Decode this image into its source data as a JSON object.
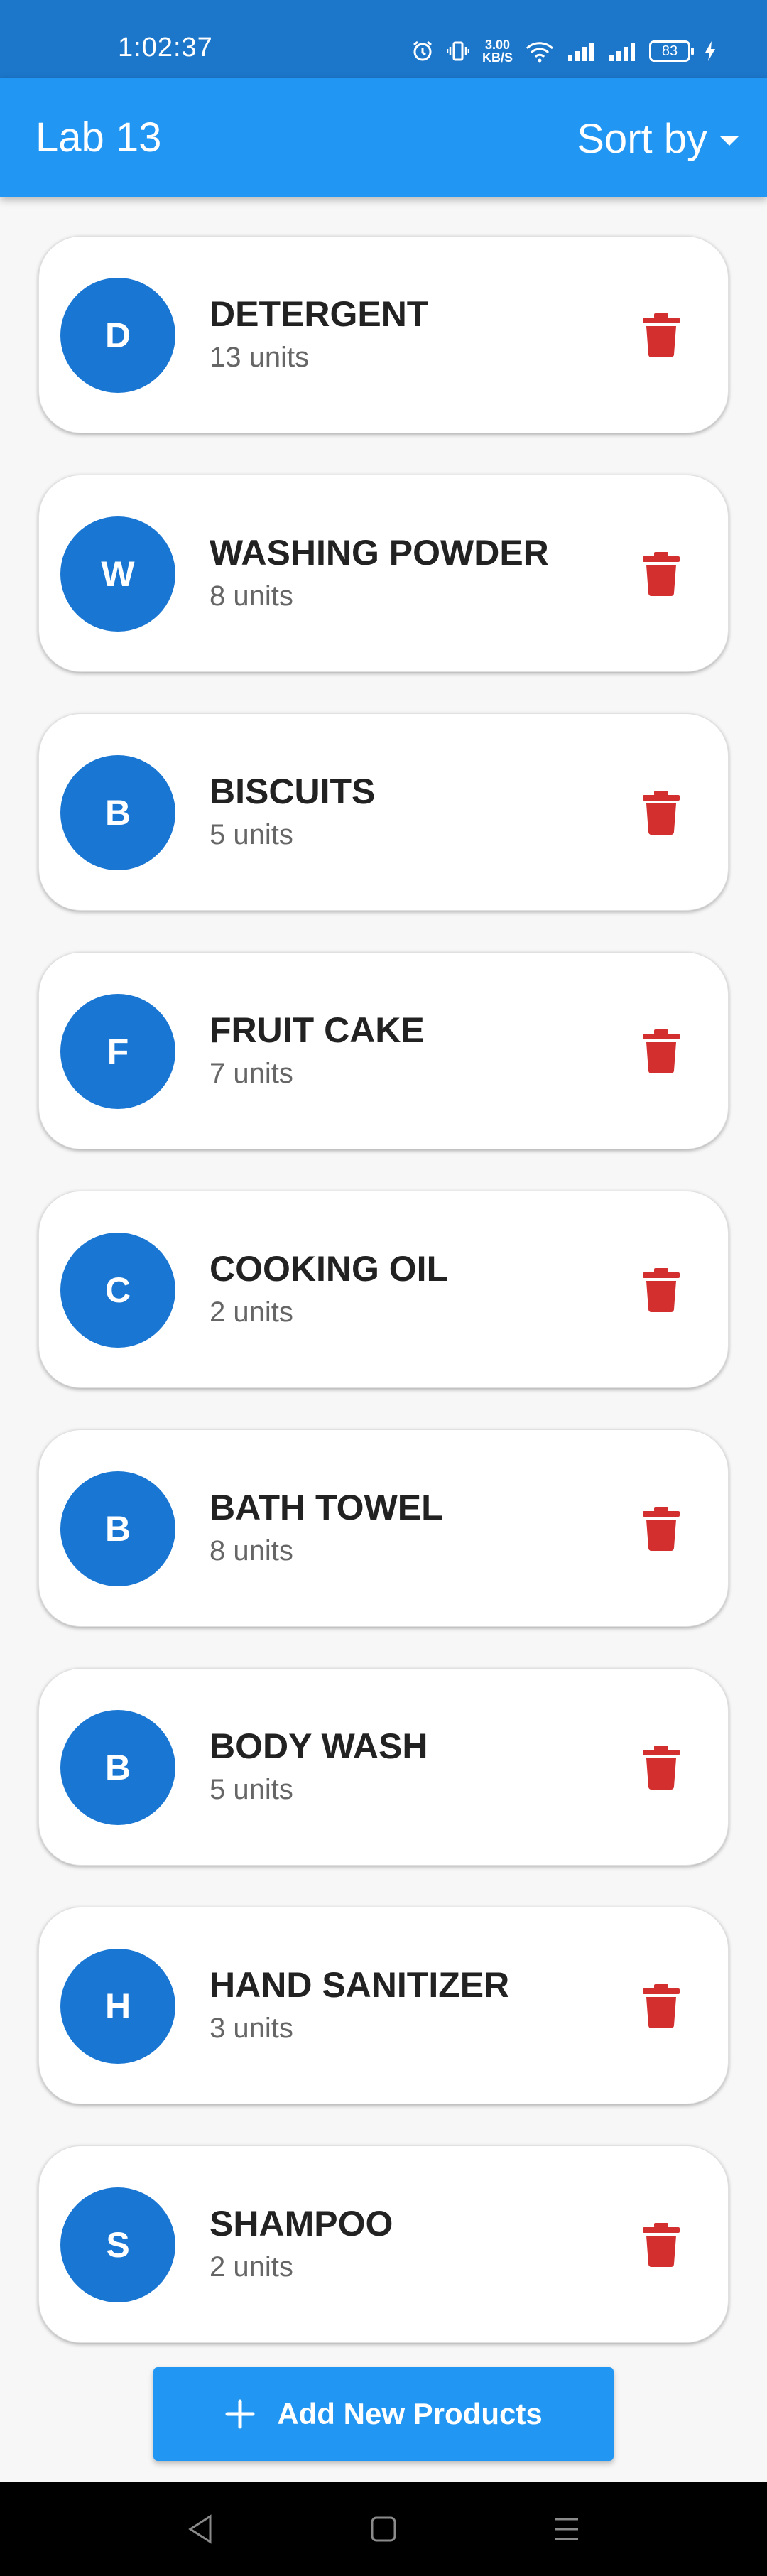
{
  "status_bar": {
    "time": "1:02:37",
    "net_speed_value": "3.00",
    "net_speed_unit": "KB/S",
    "battery": "83"
  },
  "app_bar": {
    "title": "Lab 13",
    "sort_label": "Sort by"
  },
  "products": [
    {
      "initial": "D",
      "name": "DETERGENT",
      "quantity": "13 units"
    },
    {
      "initial": "W",
      "name": "WASHING POWDER",
      "quantity": "8 units"
    },
    {
      "initial": "B",
      "name": "BISCUITS",
      "quantity": "5 units"
    },
    {
      "initial": "F",
      "name": "FRUIT CAKE",
      "quantity": "7 units"
    },
    {
      "initial": "C",
      "name": "COOKING OIL",
      "quantity": "2 units"
    },
    {
      "initial": "B",
      "name": "BATH TOWEL",
      "quantity": "8 units"
    },
    {
      "initial": "B",
      "name": "BODY WASH",
      "quantity": "5 units"
    },
    {
      "initial": "H",
      "name": "HAND SANITIZER",
      "quantity": "3 units"
    },
    {
      "initial": "S",
      "name": "SHAMPOO",
      "quantity": "2 units"
    }
  ],
  "add_button": {
    "label": "Add New Products",
    "icon": "plus-icon"
  },
  "colors": {
    "status_bar": "#1c76c9",
    "app_bar": "#2196f3",
    "avatar": "#1976d2",
    "delete": "#d32f2f"
  }
}
